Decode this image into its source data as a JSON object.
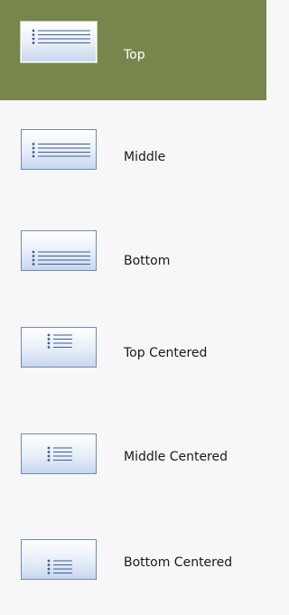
{
  "menu": {
    "items": [
      {
        "label": "Top",
        "icon": "bulleted-list-top-icon",
        "selected": true
      },
      {
        "label": "Middle",
        "icon": "bulleted-list-middle-icon",
        "selected": false
      },
      {
        "label": "Bottom",
        "icon": "bulleted-list-bottom-icon",
        "selected": false
      },
      {
        "label": "Top Centered",
        "icon": "bulleted-list-top-centered-icon",
        "selected": false
      },
      {
        "label": "Middle Centered",
        "icon": "bulleted-list-middle-centered-icon",
        "selected": false
      },
      {
        "label": "Bottom Centered",
        "icon": "bulleted-list-bottom-centered-icon",
        "selected": false
      }
    ]
  },
  "colors": {
    "selected_background": "#76864d",
    "list_background": "#f7f7f7",
    "icon_border": "#6f8ab5",
    "bullet_line": "#3e5d96"
  }
}
